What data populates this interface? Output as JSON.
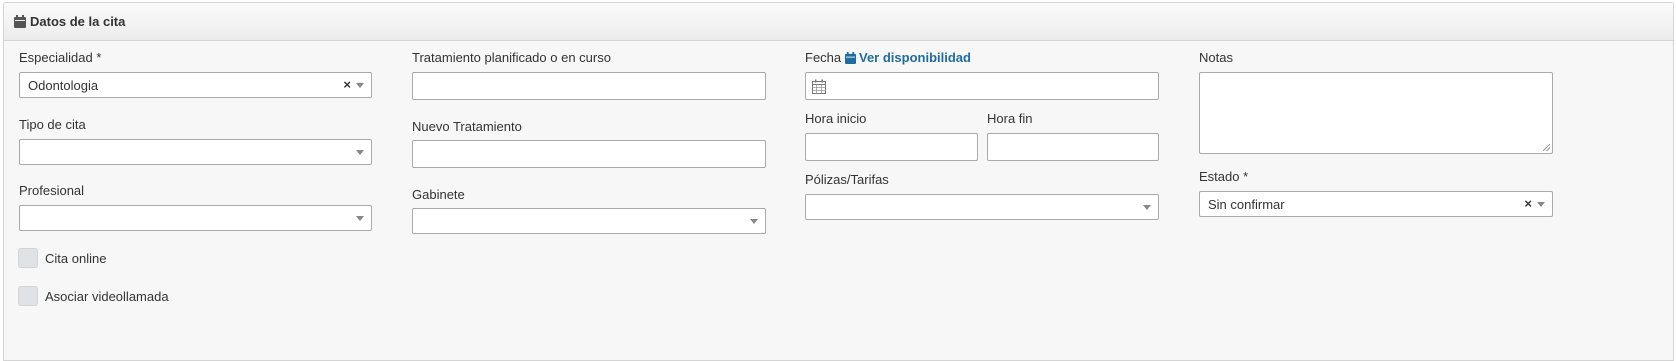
{
  "panel": {
    "title": "Datos de la cita",
    "title_icon": "calendar-icon"
  },
  "col1": {
    "especialidad": {
      "label": "Especialidad *",
      "value": "Odontologia",
      "clear": "×"
    },
    "tipo_cita": {
      "label": "Tipo de cita",
      "value": ""
    },
    "profesional": {
      "label": "Profesional",
      "value": ""
    },
    "cita_online": {
      "label": "Cita online",
      "checked": false
    },
    "videollamada": {
      "label": "Asociar videollamada",
      "checked": false
    }
  },
  "col2": {
    "tratamiento_planificado": {
      "label": "Tratamiento planificado o en curso",
      "value": ""
    },
    "nuevo_tratamiento": {
      "label": "Nuevo Tratamiento",
      "value": ""
    },
    "gabinete": {
      "label": "Gabinete",
      "value": ""
    }
  },
  "col3": {
    "fecha": {
      "label": "Fecha",
      "value": "",
      "icon": "calendar-icon"
    },
    "ver_disponibilidad": {
      "label": "Ver disponibilidad",
      "icon": "calendar-icon"
    },
    "hora_inicio": {
      "label": "Hora inicio",
      "value": ""
    },
    "hora_fin": {
      "label": "Hora fin",
      "value": ""
    },
    "polizas": {
      "label": "Pólizas/Tarifas",
      "value": ""
    }
  },
  "col4": {
    "notas": {
      "label": "Notas",
      "value": ""
    },
    "estado": {
      "label": "Estado *",
      "value": "Sin confirmar",
      "clear": "×"
    }
  },
  "colors": {
    "link": "#1e6ca0",
    "panel_bg": "#f7f7f7",
    "border": "#aaaaaa"
  }
}
